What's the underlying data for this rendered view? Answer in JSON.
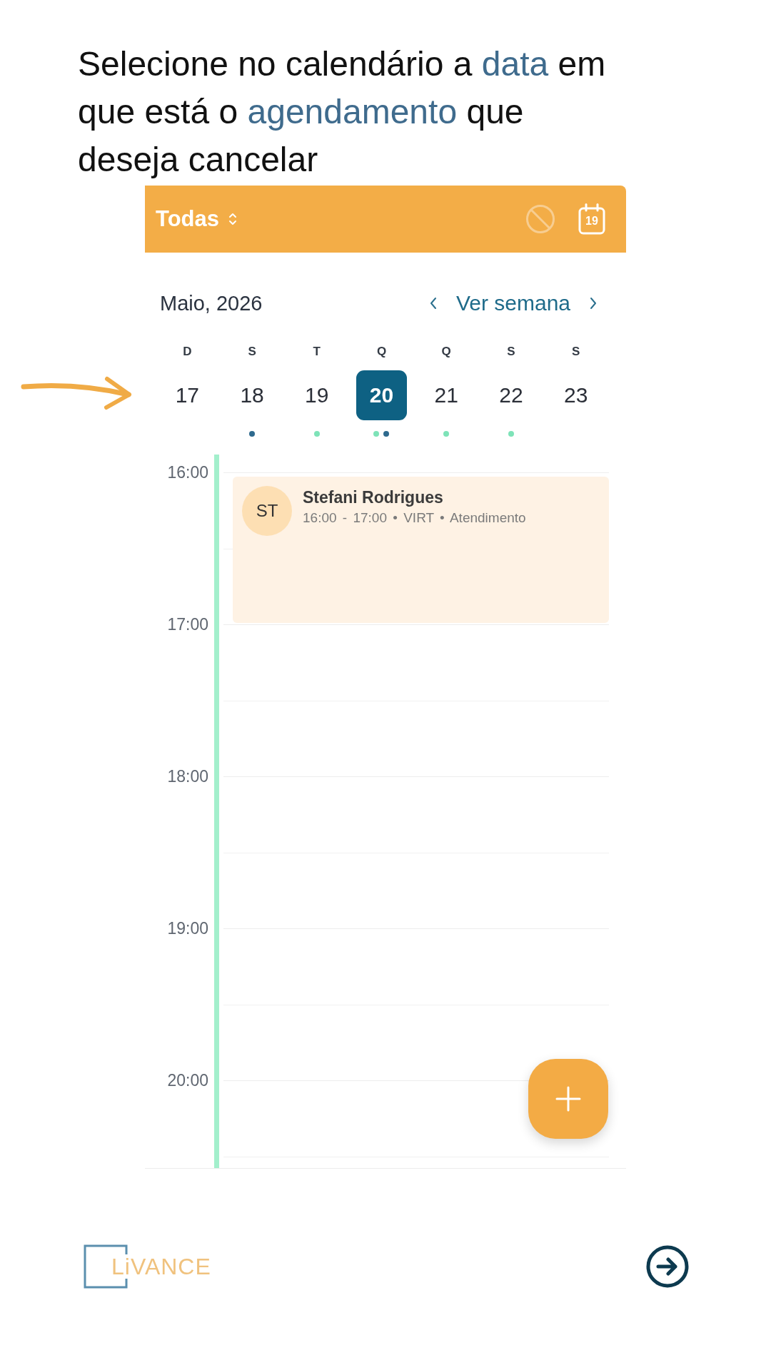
{
  "instruction": {
    "lines": [
      [
        {
          "text": "Selecione no calendário a ",
          "highlight": false
        },
        {
          "text": "data",
          "highlight": true
        },
        {
          "text": " em",
          "highlight": false
        }
      ],
      [
        {
          "text": "que está o ",
          "highlight": false
        },
        {
          "text": "agendamento",
          "highlight": true
        },
        {
          "text": " que",
          "highlight": false
        }
      ],
      [
        {
          "text": "deseja cancelar",
          "highlight": false
        }
      ]
    ]
  },
  "calendar": {
    "header": {
      "filter": "Todas",
      "actions": [
        {
          "kind": "block",
          "disabled": true
        },
        {
          "kind": "today",
          "day": "19",
          "disabled": false
        }
      ]
    },
    "month": "Maio, 2026",
    "week_toggle": "Ver semana",
    "days": [
      {
        "weekday": "D",
        "day": "17",
        "selected": false
      },
      {
        "weekday": "S",
        "day": "18",
        "selected": false,
        "dots": [
          {
            "color": "#2e6a8e"
          }
        ]
      },
      {
        "weekday": "T",
        "day": "19",
        "selected": false,
        "dots": [
          {
            "color": "#7ee3b8"
          }
        ]
      },
      {
        "weekday": "Q",
        "day": "20",
        "selected": true,
        "dots": [
          {
            "color": "#7ee3b8"
          },
          {
            "color": "#2e6a8e"
          }
        ]
      },
      {
        "weekday": "Q",
        "day": "21",
        "selected": false,
        "dots": [
          {
            "color": "#7ee3b8"
          }
        ]
      },
      {
        "weekday": "S",
        "day": "22",
        "selected": false,
        "dots": [
          {
            "color": "#7ee3b8"
          }
        ]
      },
      {
        "weekday": "S",
        "day": "23",
        "selected": false
      }
    ],
    "hours": [
      {
        "label": "16:00",
        "events": [
          {
            "initials": "ST",
            "name": "Stefani Rodrigues",
            "details": "16:00 - 17:00 • VIRT • Atendimento"
          }
        ]
      },
      {
        "label": "17:00"
      },
      {
        "label": "18:00"
      },
      {
        "label": "19:00"
      },
      {
        "label": "20:00"
      }
    ]
  },
  "footer": {
    "logo": "LiVANCE"
  }
}
